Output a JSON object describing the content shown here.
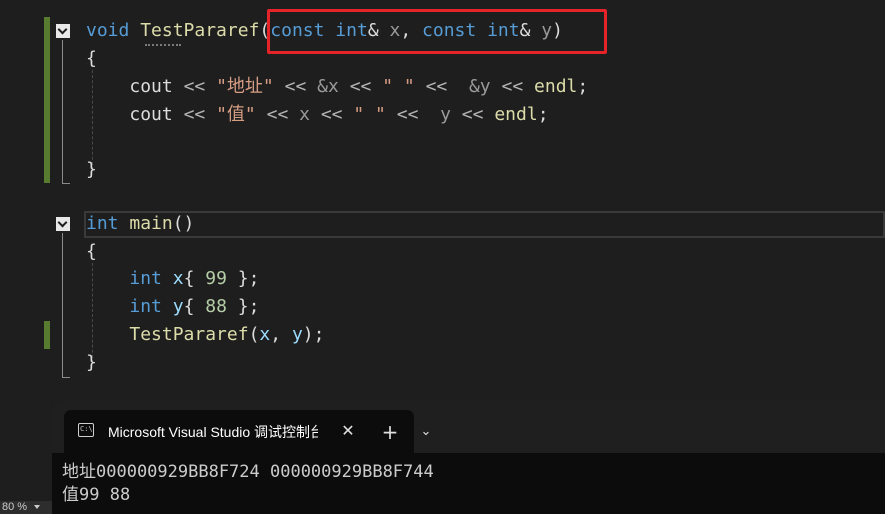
{
  "editor": {
    "func": {
      "ret": "void",
      "name": "TestPararef",
      "open_paren": "(",
      "const1": "const",
      "int1": "int",
      "amp1": "&",
      "param1": "x",
      "comma": ",",
      "const2": "const",
      "int2": "int",
      "amp2": "&",
      "param2": "y",
      "close_paren": ")"
    },
    "brace_open_1": "{",
    "line_cout1": {
      "cout": "cout",
      "shl1": "<<",
      "str": "\"地址\"",
      "shl2": "<<",
      "addr_x": "&x",
      "shl3": "<<",
      "space_str": "\" \"",
      "shl4": "<<",
      "addr_y": "&y",
      "shl5": "<<",
      "endl": "endl",
      "semi": ";"
    },
    "line_cout2": {
      "cout": "cout",
      "shl1": "<<",
      "str": "\"值\"",
      "shl2": "<<",
      "x": "x",
      "shl3": "<<",
      "space_str": "\" \"",
      "shl4": "<<",
      "y": "y",
      "shl5": "<<",
      "endl": "endl",
      "semi": ";"
    },
    "brace_close_1": "}",
    "main_sig": {
      "int": "int",
      "name": "main",
      "parens": "()"
    },
    "brace_open_2": "{",
    "decl_x": {
      "int": "int",
      "name": "x",
      "open": "{",
      "value": "99",
      "close": "};"
    },
    "decl_y": {
      "int": "int",
      "name": "y",
      "open": "{",
      "value": "88",
      "close": "};"
    },
    "call": {
      "name": "TestPararef",
      "open": "(",
      "a": "x",
      "comma": ",",
      "b": "y",
      "close": ");"
    },
    "brace_close_2": "}"
  },
  "status": {
    "zoom": "80 %"
  },
  "terminal": {
    "tab_icon_text": "C:\\",
    "tab_title": "Microsoft Visual Studio 调试控制台",
    "close_symbol": "✕",
    "new_tab_symbol": "+",
    "dropdown_symbol": "⌄",
    "output_line1": "地址000000929BB8F724 000000929BB8F744",
    "output_line2": "值99 88"
  },
  "colors": {
    "background": "#1e1e1e",
    "keyword": "#569cd6",
    "function": "#dcdcaa",
    "string": "#d69d85",
    "number": "#b5cea8",
    "variable": "#9cdcfe",
    "highlight_box": "#e5242a",
    "change_bar": "#587c2f"
  }
}
